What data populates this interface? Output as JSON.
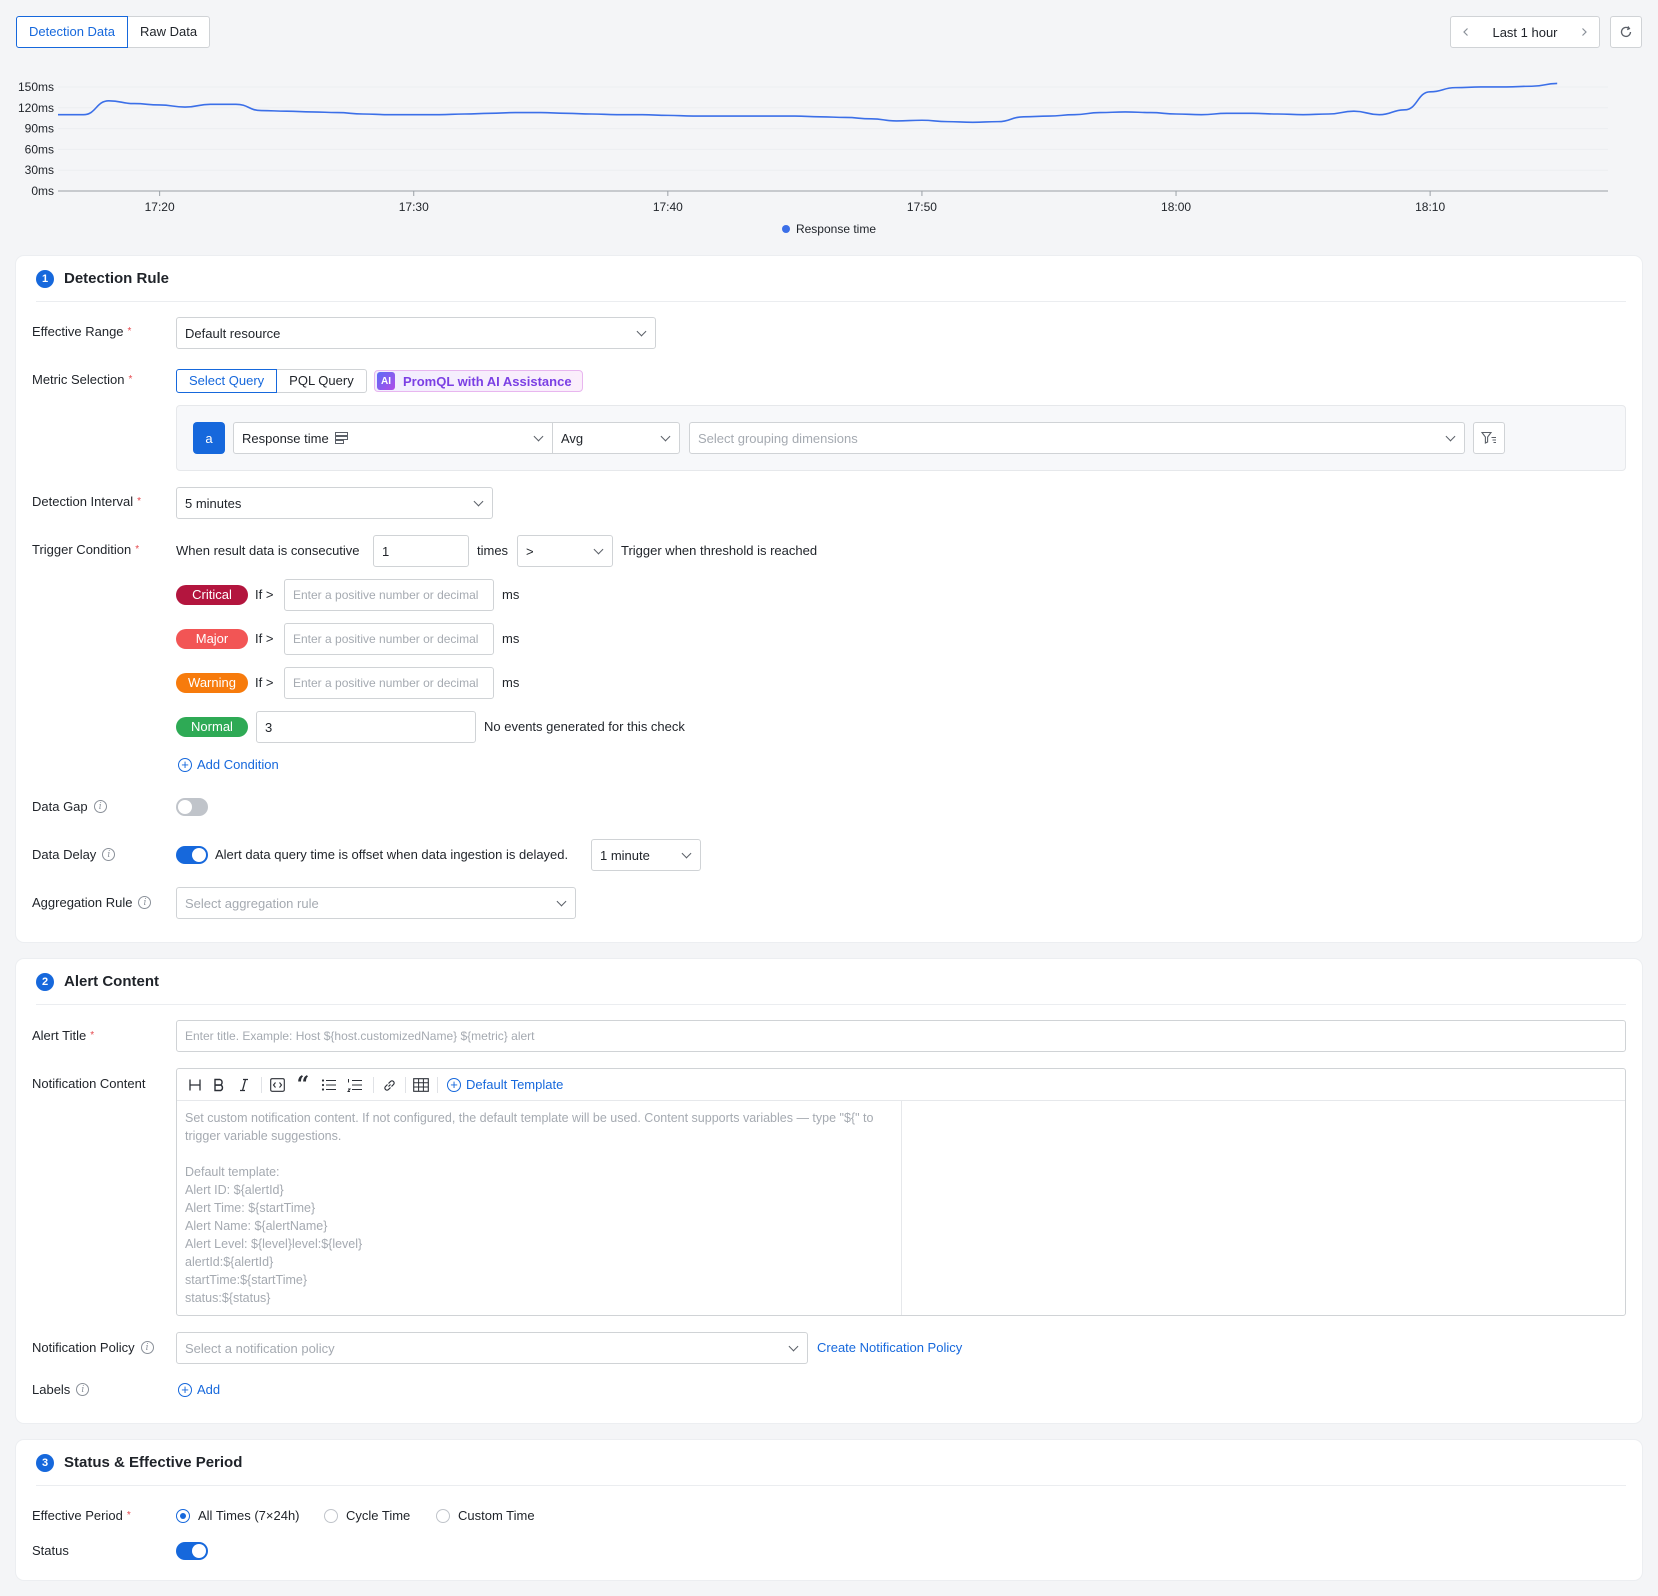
{
  "tabs": {
    "detection": "Detection Data",
    "raw": "Raw Data"
  },
  "time_range": {
    "label": "Last 1 hour",
    "prev_icon": "chevron-left-icon",
    "next_icon": "chevron-right-icon",
    "refresh_icon": "refresh-icon"
  },
  "chart_data": {
    "type": "line",
    "x_ticks": [
      "17:20",
      "17:30",
      "17:40",
      "17:50",
      "18:00",
      "18:10"
    ],
    "y_ticks": [
      "150ms",
      "120ms",
      "90ms",
      "60ms",
      "30ms",
      "0ms"
    ],
    "ylim": [
      0,
      160
    ],
    "x_range_minutes": [
      "17:16",
      "18:17"
    ],
    "series": [
      {
        "name": "Response time",
        "color": "#3b6fe8",
        "points": [
          [
            "17:16",
            110
          ],
          [
            "17:17",
            110
          ],
          [
            "17:18",
            130
          ],
          [
            "17:19",
            126
          ],
          [
            "17:20",
            124
          ],
          [
            "17:21",
            121
          ],
          [
            "17:22",
            125
          ],
          [
            "17:23",
            125
          ],
          [
            "17:24",
            116
          ],
          [
            "17:25",
            115
          ],
          [
            "17:26",
            114
          ],
          [
            "17:27",
            113
          ],
          [
            "17:28",
            111
          ],
          [
            "17:29",
            110
          ],
          [
            "17:30",
            110
          ],
          [
            "17:31",
            110
          ],
          [
            "17:32",
            111
          ],
          [
            "17:33",
            112
          ],
          [
            "17:34",
            113
          ],
          [
            "17:35",
            113
          ],
          [
            "17:36",
            112
          ],
          [
            "17:37",
            111
          ],
          [
            "17:38",
            110
          ],
          [
            "17:39",
            110
          ],
          [
            "17:40",
            109
          ],
          [
            "17:41",
            108
          ],
          [
            "17:42",
            108
          ],
          [
            "17:43",
            108
          ],
          [
            "17:44",
            108
          ],
          [
            "17:45",
            108
          ],
          [
            "17:46",
            107
          ],
          [
            "17:47",
            106
          ],
          [
            "17:48",
            104
          ],
          [
            "17:49",
            101
          ],
          [
            "17:50",
            102
          ],
          [
            "17:51",
            100
          ],
          [
            "17:52",
            99
          ],
          [
            "17:53",
            100
          ],
          [
            "17:54",
            107
          ],
          [
            "17:55",
            108
          ],
          [
            "17:56",
            110
          ],
          [
            "17:57",
            113
          ],
          [
            "17:58",
            114
          ],
          [
            "17:59",
            113
          ],
          [
            "18:00",
            111
          ],
          [
            "18:01",
            110
          ],
          [
            "18:02",
            112
          ],
          [
            "18:03",
            112
          ],
          [
            "18:04",
            111
          ],
          [
            "18:05",
            110
          ],
          [
            "18:06",
            111
          ],
          [
            "18:07",
            115
          ],
          [
            "18:08",
            110
          ],
          [
            "18:09",
            117
          ],
          [
            "18:10",
            143
          ],
          [
            "18:11",
            149
          ],
          [
            "18:12",
            150
          ],
          [
            "18:13",
            150
          ],
          [
            "18:14",
            151
          ],
          [
            "18:15",
            155
          ]
        ]
      }
    ],
    "legend": "Response time",
    "grid": true
  },
  "detection_rule": {
    "step": "1",
    "title": "Detection Rule",
    "effective_range": {
      "label": "Effective Range",
      "value": "Default resource"
    },
    "metric_selection": {
      "label": "Metric Selection",
      "modes": [
        "Select Query",
        "PQL Query"
      ],
      "active_mode": "Select Query",
      "ai_badge": "AI",
      "ai_button": "PromQL with AI Assistance",
      "query_label": "a",
      "metric": "Response time",
      "aggregation": "Avg",
      "grouping_placeholder": "Select grouping dimensions"
    },
    "detection_interval": {
      "label": "Detection Interval",
      "value": "5 minutes"
    },
    "trigger_condition": {
      "label": "Trigger Condition",
      "prefix": "When result data is consecutive",
      "count": "1",
      "times": "times",
      "operator": ">",
      "suffix": "Trigger when threshold is reached",
      "levels": [
        {
          "name": "Critical",
          "if": "If >",
          "placeholder": "Enter a positive number or decimal",
          "unit": "ms",
          "color": "#b3153e"
        },
        {
          "name": "Major",
          "if": "If >",
          "placeholder": "Enter a positive number or decimal",
          "unit": "ms",
          "color": "#f25555"
        },
        {
          "name": "Warning",
          "if": "If >",
          "placeholder": "Enter a positive number or decimal",
          "unit": "ms",
          "color": "#f77b0c"
        }
      ],
      "normal": {
        "name": "Normal",
        "value": "3",
        "note": "No events generated for this check",
        "color": "#2eaa55"
      },
      "add_condition": "Add Condition"
    },
    "data_gap": {
      "label": "Data Gap",
      "enabled": false
    },
    "data_delay": {
      "label": "Data Delay",
      "enabled": true,
      "text": "Alert data query time is offset when data ingestion is delayed.",
      "value": "1 minute"
    },
    "aggregation_rule": {
      "label": "Aggregation Rule",
      "placeholder": "Select aggregation rule"
    }
  },
  "alert_content": {
    "step": "2",
    "title": "Alert Content",
    "alert_title": {
      "label": "Alert Title",
      "placeholder": "Enter title. Example: Host ${host.customizedName} ${metric} alert"
    },
    "notification_content": {
      "label": "Notification Content",
      "toolbar": [
        "heading-icon",
        "bold-icon",
        "italic-icon",
        "code-block-icon",
        "quote-icon",
        "bullet-list-icon",
        "ordered-list-icon",
        "link-icon",
        "table-icon"
      ],
      "default_template": "Default Template",
      "placeholder": "Set custom notification content. If not configured, the default template will be used. Content supports variables — type \"${\" to trigger variable suggestions.\n\nDefault template:\nAlert ID: ${alertId}\nAlert Time: ${startTime}\nAlert Name: ${alertName}\nAlert Level: ${level}level:${level}\nalertId:${alertId}\nstartTime:${startTime}\nstatus:${status}"
    },
    "notification_policy": {
      "label": "Notification Policy",
      "placeholder": "Select a notification policy",
      "create_link": "Create Notification Policy"
    },
    "labels": {
      "label": "Labels",
      "add": "Add"
    }
  },
  "status_period": {
    "step": "3",
    "title": "Status & Effective Period",
    "effective_period": {
      "label": "Effective Period",
      "options": [
        "All Times (7×24h)",
        "Cycle Time",
        "Custom Time"
      ],
      "selected": "All Times (7×24h)"
    },
    "status": {
      "label": "Status",
      "enabled": true
    }
  }
}
